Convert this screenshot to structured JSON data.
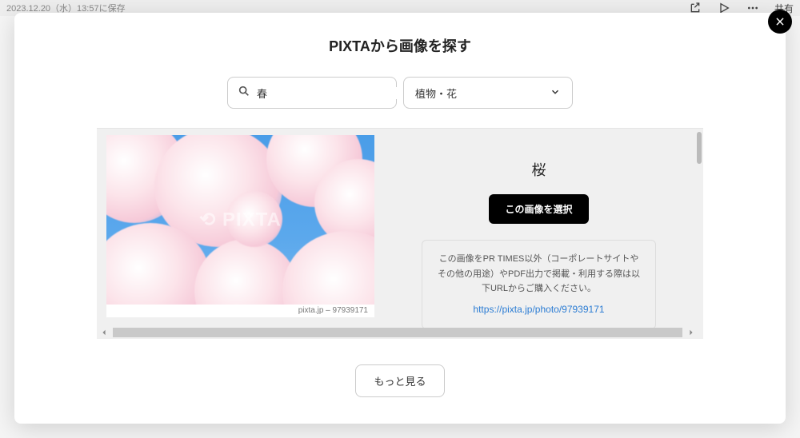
{
  "topbar": {
    "timestamp": "2023.12.20（水）13:57に保存",
    "share_label": "共有"
  },
  "modal": {
    "title": "PIXTAから画像を探す",
    "search_value": "春",
    "category_value": "植物・花"
  },
  "image": {
    "title": "桜",
    "watermark": "⟲ PIXTA",
    "caption": "pixta.jp – 97939171",
    "select_label": "この画像を選択"
  },
  "note": {
    "text": "この画像をPR TIMES以外（コーポレートサイトやその他の用途）やPDF出力で掲載・利用する際は以下URLからご購入ください。",
    "url": "https://pixta.jp/photo/97939171"
  },
  "more_label": "もっと見る"
}
